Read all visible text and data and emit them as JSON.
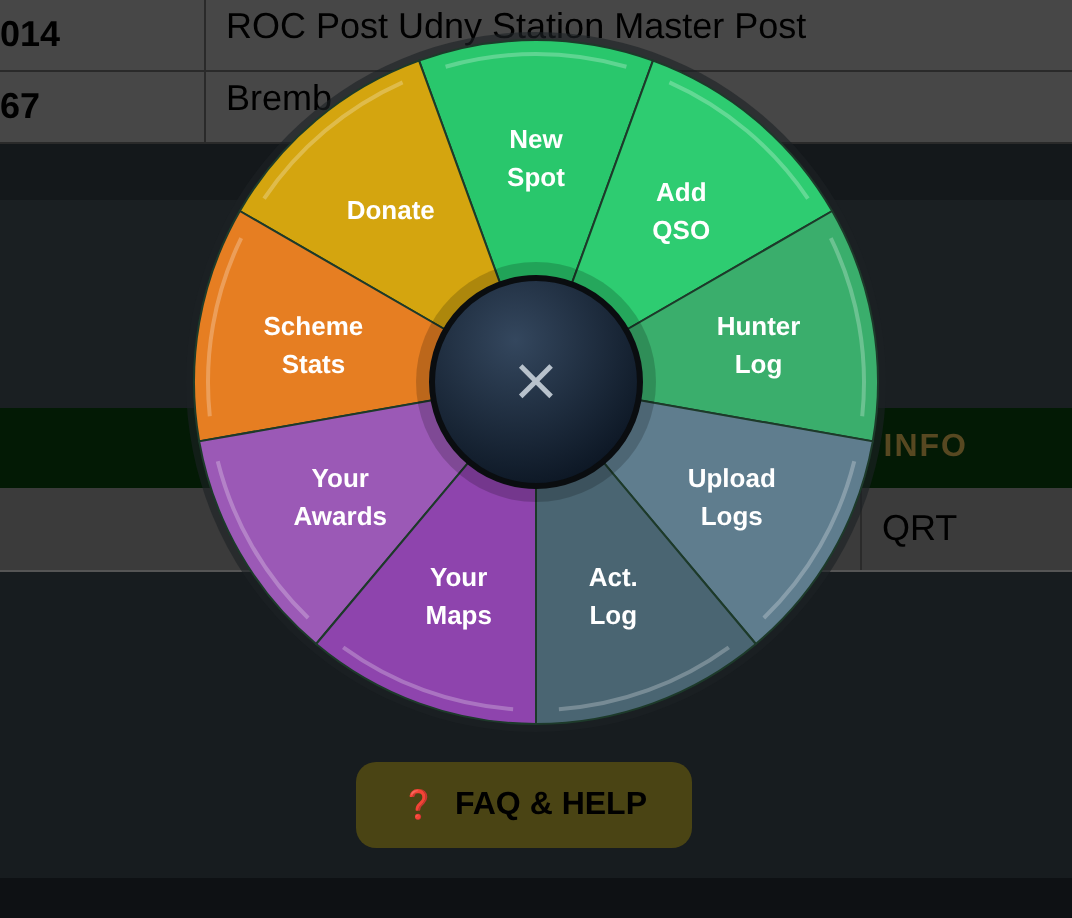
{
  "table_rows": [
    {
      "id": "014",
      "name": "ROC Post Udny Station Master Post"
    },
    {
      "id": "67",
      "name": "Bremb"
    }
  ],
  "info_header": {
    "label": "INFO"
  },
  "status_row": {
    "value": "QRT"
  },
  "faq_button": {
    "icon": "❓",
    "label": "FAQ & HELP"
  },
  "radial_menu": {
    "close_label": "×",
    "right_segments": [
      {
        "label": "New Spot",
        "color": "#29c76c"
      },
      {
        "label": "Add QSO",
        "color": "#2ecc71"
      },
      {
        "label": "Hunter Log",
        "color": "#3aae6c"
      },
      {
        "label": "Upload Logs",
        "color": "#5f7d8e"
      },
      {
        "label": "Act. Log",
        "color": "#4a6572"
      }
    ],
    "left_segments": [
      {
        "label": "Donate",
        "color": "#d4a50f"
      },
      {
        "label": "Scheme Stats",
        "color": "#e67e22"
      },
      {
        "label": "Your Awards",
        "color": "#9b59b6"
      },
      {
        "label": "Your Maps",
        "color": "#8e44ad"
      }
    ]
  }
}
